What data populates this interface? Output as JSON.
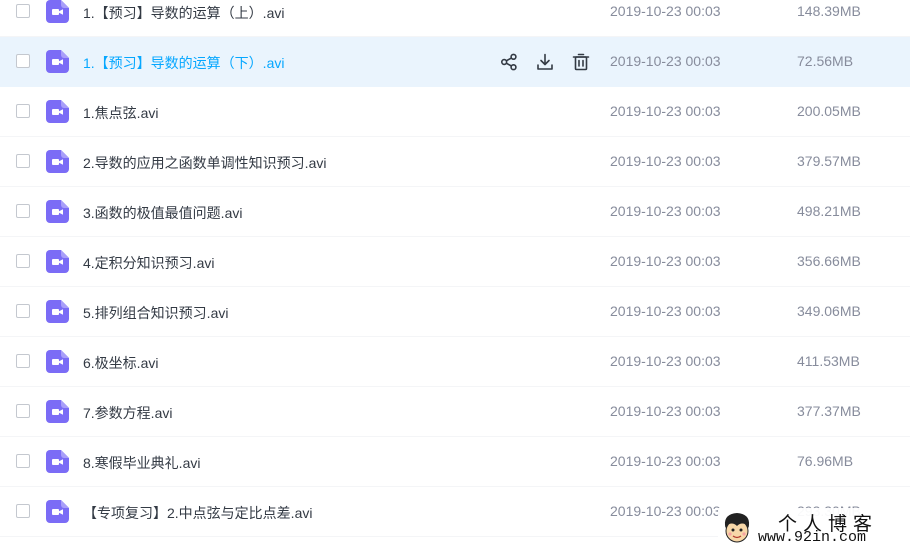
{
  "colors": {
    "accent": "#06a7ff",
    "hover_row": "#eaf4fd",
    "file_icon": "#7b6cf6",
    "meta_text": "#878c9c"
  },
  "files": [
    {
      "name": "1.【预习】导数的运算（上）.avi",
      "date": "2019-10-23 00:03",
      "size": "148.39MB"
    },
    {
      "name": "1.【预习】导数的运算（下）.avi",
      "date": "2019-10-23 00:03",
      "size": "72.56MB",
      "hover": true
    },
    {
      "name": "1.焦点弦.avi",
      "date": "2019-10-23 00:03",
      "size": "200.05MB"
    },
    {
      "name": "2.导数的应用之函数单调性知识预习.avi",
      "date": "2019-10-23 00:03",
      "size": "379.57MB"
    },
    {
      "name": "3.函数的极值最值问题.avi",
      "date": "2019-10-23 00:03",
      "size": "498.21MB"
    },
    {
      "name": "4.定积分知识预习.avi",
      "date": "2019-10-23 00:03",
      "size": "356.66MB"
    },
    {
      "name": "5.排列组合知识预习.avi",
      "date": "2019-10-23 00:03",
      "size": "349.06MB"
    },
    {
      "name": "6.极坐标.avi",
      "date": "2019-10-23 00:03",
      "size": "411.53MB"
    },
    {
      "name": "7.参数方程.avi",
      "date": "2019-10-23 00:03",
      "size": "377.37MB"
    },
    {
      "name": "8.寒假毕业典礼.avi",
      "date": "2019-10-23 00:03",
      "size": "76.96MB"
    },
    {
      "name": "【专项复习】2.中点弦与定比点差.avi",
      "date": "2019-10-23 00:03",
      "size": "293.30MB"
    }
  ],
  "row_actions": {
    "icons": [
      "share-icon",
      "download-icon",
      "delete-icon"
    ]
  },
  "watermark": {
    "title": "个人博客",
    "url": "www.92in.com"
  }
}
